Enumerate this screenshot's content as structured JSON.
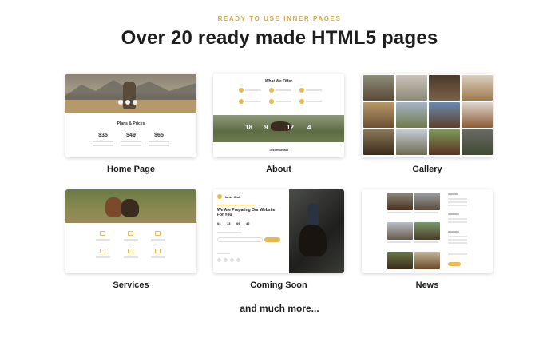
{
  "section": {
    "eyebrow": "READY TO USE INNER PAGES",
    "headline": "Over 20 ready made HTML5 pages"
  },
  "cards": [
    {
      "id": "home",
      "label": "Home Page"
    },
    {
      "id": "about",
      "label": "About"
    },
    {
      "id": "gallery",
      "label": "Gallery"
    },
    {
      "id": "services",
      "label": "Services"
    },
    {
      "id": "coming-soon",
      "label": "Coming Soon"
    },
    {
      "id": "news",
      "label": "News"
    }
  ],
  "home_preview": {
    "section_title": "Plans & Prices",
    "prices": [
      "$35",
      "$49",
      "$65"
    ]
  },
  "about_preview": {
    "section_title": "What We Offer",
    "stats": [
      "18",
      "9",
      "12",
      "4"
    ],
    "footer_title": "Testimonials"
  },
  "coming_soon_preview": {
    "brand": "Horse Club",
    "heading": "We Are Preparing Our Website For You",
    "countdown": [
      "04",
      "13",
      "09",
      "42"
    ]
  },
  "footer": {
    "more": "and much more..."
  },
  "colors": {
    "accent": "#d8a640",
    "text": "#1d1d1d"
  }
}
